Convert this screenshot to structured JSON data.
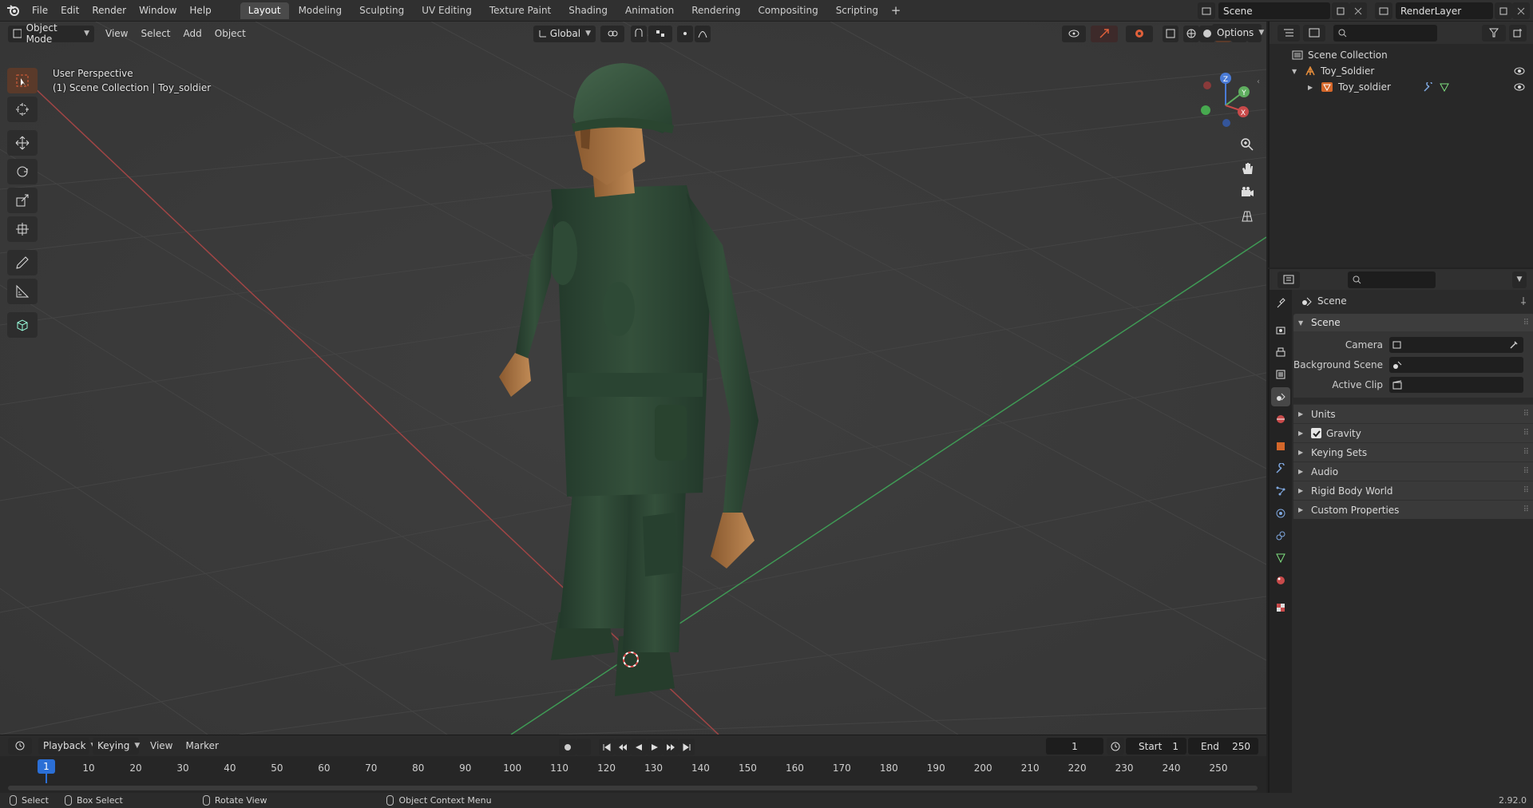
{
  "menu": [
    "File",
    "Edit",
    "Render",
    "Window",
    "Help"
  ],
  "workspaces": {
    "tabs": [
      "Layout",
      "Modeling",
      "Sculpting",
      "UV Editing",
      "Texture Paint",
      "Shading",
      "Animation",
      "Rendering",
      "Compositing",
      "Scripting"
    ],
    "active": "Layout",
    "add_label": "+"
  },
  "scene_field": "Scene",
  "view_layer_field": "RenderLayer",
  "viewport": {
    "mode": "Object Mode",
    "menus": [
      "View",
      "Select",
      "Add",
      "Object"
    ],
    "transform_orientation": "Global",
    "options_label": "Options",
    "perspective_label": "User Perspective",
    "collection_label": "(1) Scene Collection | Toy_soldier",
    "gizmo_axes": {
      "x": "X",
      "y": "Y",
      "z": "Z"
    }
  },
  "timeline": {
    "menus": [
      "Playback",
      "Keying",
      "View",
      "Marker"
    ],
    "current_frame": "1",
    "start_label": "Start",
    "start_value": "1",
    "end_label": "End",
    "end_value": "250",
    "ticks": [
      "10",
      "20",
      "30",
      "40",
      "50",
      "60",
      "70",
      "80",
      "90",
      "100",
      "110",
      "120",
      "130",
      "140",
      "150",
      "160",
      "170",
      "180",
      "190",
      "200",
      "210",
      "220",
      "230",
      "240",
      "250"
    ],
    "cursor_label": "1"
  },
  "statusbar": {
    "select": "Select",
    "box_select": "Box Select",
    "rotate_view": "Rotate View",
    "context_menu": "Object Context Menu",
    "version": "2.92.0"
  },
  "outliner": {
    "root": "Scene Collection",
    "collection": "Toy_Soldier",
    "object": "Toy_soldier"
  },
  "properties": {
    "header_title": "Scene",
    "panel_title": "Scene",
    "rows": [
      {
        "label": "Camera"
      },
      {
        "label": "Background Scene"
      },
      {
        "label": "Active Clip"
      }
    ],
    "subpanels": [
      "Units",
      "Gravity",
      "Keying Sets",
      "Audio",
      "Rigid Body World",
      "Custom Properties"
    ],
    "gravity_checked": true
  },
  "colors": {
    "accent_blue": "#2b6fd6",
    "active_tool": "#d4672a",
    "axis_x": "#c84a4a",
    "axis_y": "#5fae5f",
    "axis_z": "#4a7bd6",
    "soldier_green": "#2f4a35"
  }
}
